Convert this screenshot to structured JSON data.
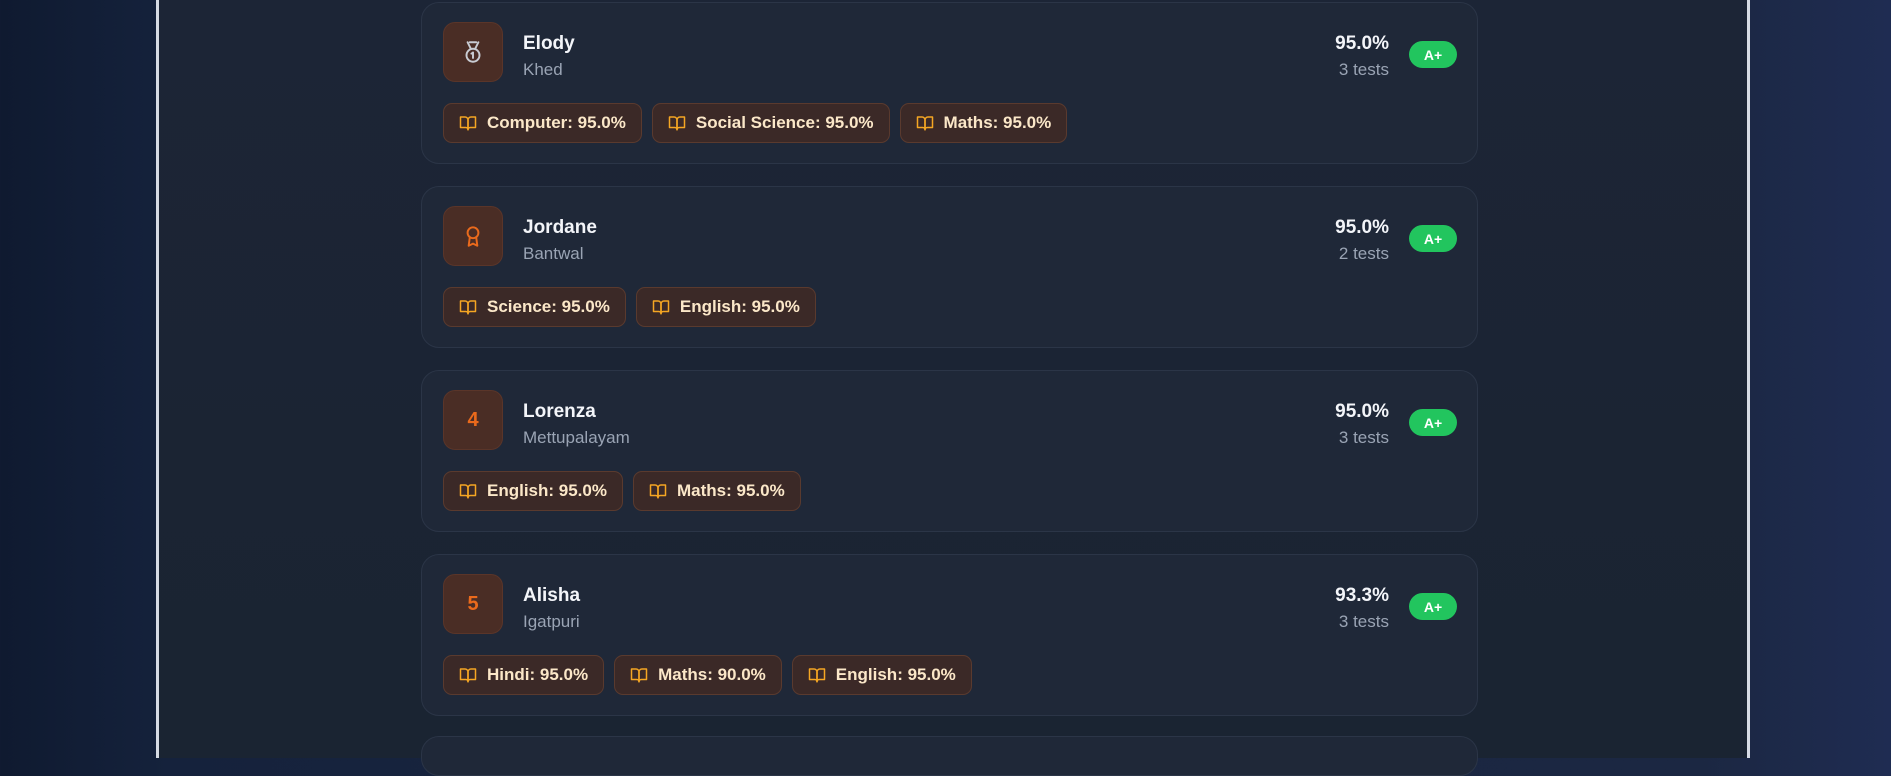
{
  "colors": {
    "accent_orange": "#ea6a1c",
    "grade_green": "#22c55e",
    "chip_text": "#fbe7c8",
    "book_icon": "#f5a623"
  },
  "students": [
    {
      "rank_icon": "medal-icon",
      "rank_label": "",
      "name": "Elody",
      "location": "Khed",
      "percentage": "95.0%",
      "tests": "3 tests",
      "grade": "A+",
      "subjects": [
        "Computer: 95.0%",
        "Social Science: 95.0%",
        "Maths: 95.0%"
      ]
    },
    {
      "rank_icon": "award-ribbon-icon",
      "rank_label": "",
      "name": "Jordane",
      "location": "Bantwal",
      "percentage": "95.0%",
      "tests": "2 tests",
      "grade": "A+",
      "subjects": [
        "Science: 95.0%",
        "English: 95.0%"
      ]
    },
    {
      "rank_icon": "",
      "rank_label": "4",
      "name": "Lorenza",
      "location": "Mettupalayam",
      "percentage": "95.0%",
      "tests": "3 tests",
      "grade": "A+",
      "subjects": [
        "English: 95.0%",
        "Maths: 95.0%"
      ]
    },
    {
      "rank_icon": "",
      "rank_label": "5",
      "name": "Alisha",
      "location": "Igatpuri",
      "percentage": "93.3%",
      "tests": "3 tests",
      "grade": "A+",
      "subjects": [
        "Hindi: 95.0%",
        "Maths: 90.0%",
        "English: 95.0%"
      ]
    }
  ]
}
